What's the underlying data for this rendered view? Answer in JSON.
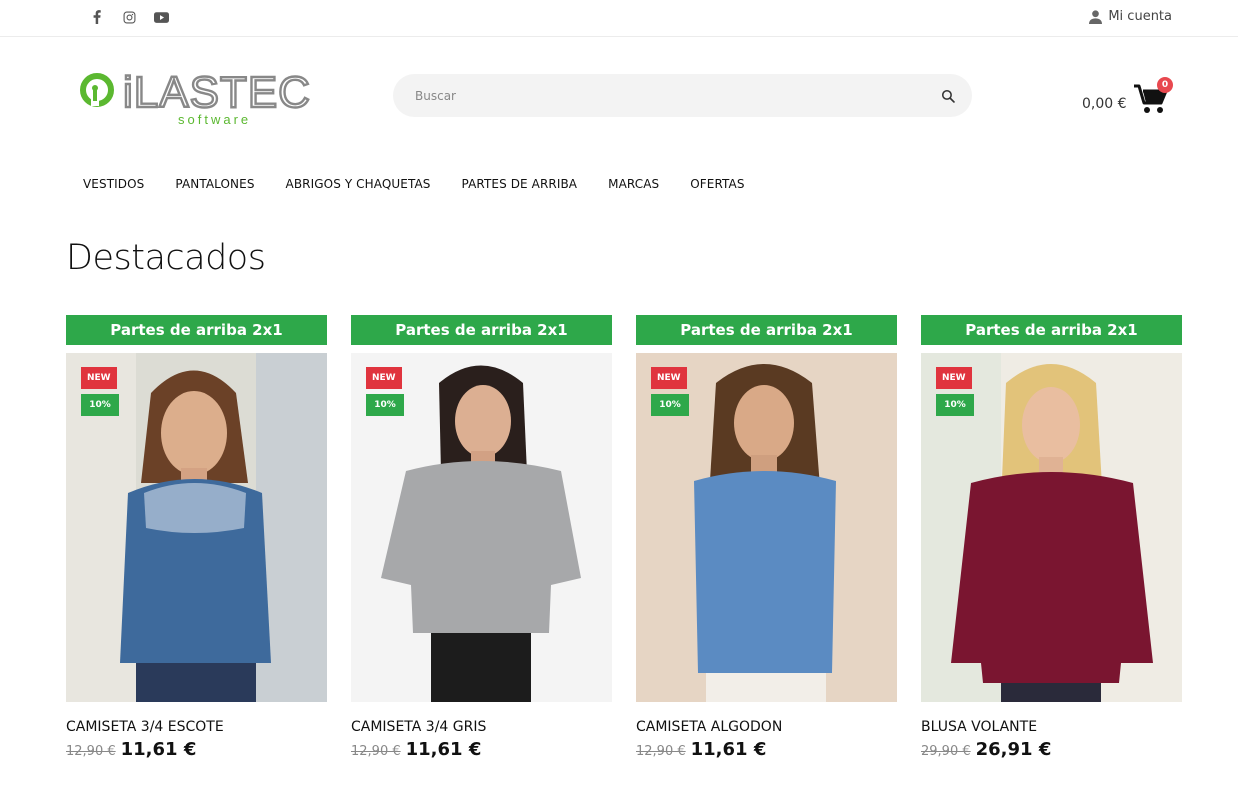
{
  "topbar": {
    "social": [
      {
        "icon": "facebook-icon"
      },
      {
        "icon": "instagram-icon"
      },
      {
        "icon": "youtube-icon"
      }
    ],
    "account_label": "Mi cuenta"
  },
  "header": {
    "logo_text": "iLASTEC",
    "logo_sub": "software",
    "search_placeholder": "Buscar",
    "cart_total": "0,00 €",
    "cart_count": "0"
  },
  "nav": [
    "VESTIDOS",
    "PANTALONES",
    "ABRIGOS Y CHAQUETAS",
    "PARTES DE ARRIBA",
    "MARCAS",
    "OFERTAS"
  ],
  "section_title": "Destacados",
  "products": [
    {
      "promo": "Partes de arriba 2x1",
      "badge_new": "NEW",
      "badge_discount": "10%",
      "name": "CAMISETA 3/4 ESCOTE",
      "old_price": "12,90 €",
      "price": "11,61 €"
    },
    {
      "promo": "Partes de arriba 2x1",
      "badge_new": "NEW",
      "badge_discount": "10%",
      "name": "CAMISETA 3/4 GRIS",
      "old_price": "12,90 €",
      "price": "11,61 €"
    },
    {
      "promo": "Partes de arriba 2x1",
      "badge_new": "NEW",
      "badge_discount": "10%",
      "name": "CAMISETA ALGODON",
      "old_price": "12,90 €",
      "price": "11,61 €"
    },
    {
      "promo": "Partes de arriba 2x1",
      "badge_new": "NEW",
      "badge_discount": "10%",
      "name": "BLUSA VOLANTE",
      "old_price": "29,90 €",
      "price": "26,91 €"
    }
  ],
  "colors": {
    "accent_green": "#2ea84a",
    "badge_red": "#e0343e",
    "cart_badge": "#e8484f"
  }
}
